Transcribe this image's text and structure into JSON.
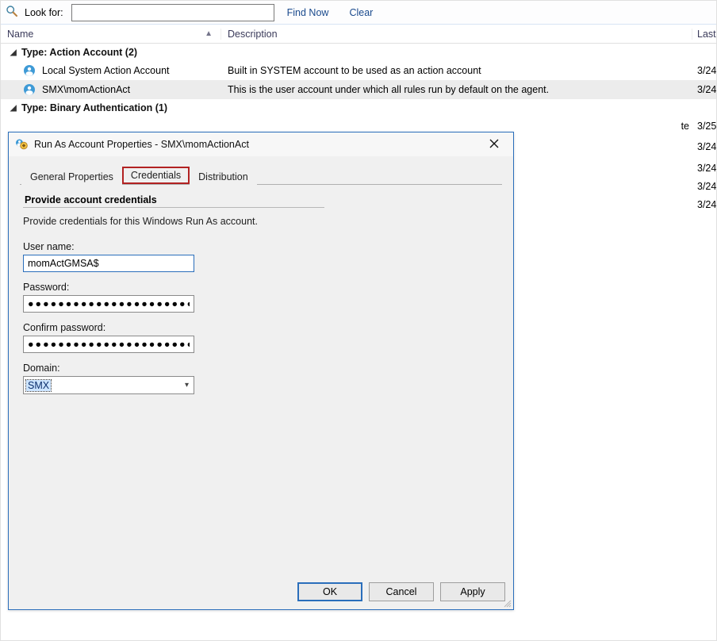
{
  "search": {
    "label": "Look for:",
    "value": "",
    "findNow": "Find Now",
    "clear": "Clear"
  },
  "columns": {
    "name": "Name",
    "description": "Description",
    "last": "Last"
  },
  "groups": [
    {
      "title": "Type: Action Account (2)",
      "rows": [
        {
          "name": "Local System Action Account",
          "desc": "Built in SYSTEM account to be used as an action account",
          "date": "3/24",
          "selected": false
        },
        {
          "name": "SMX\\momActionAct",
          "desc": "This is the user account under which all rules run by default on the agent.",
          "date": "3/24",
          "selected": true
        }
      ]
    },
    {
      "title": "Type: Binary Authentication (1)",
      "rows": []
    }
  ],
  "obscured_rows": [
    {
      "tail": "te",
      "date": "3/25"
    },
    {
      "date": "3/24"
    },
    {
      "date": "3/24"
    },
    {
      "date": "3/24"
    },
    {
      "date": "3/24"
    }
  ],
  "dialog": {
    "title": "Run As Account Properties - SMX\\momActionAct",
    "tabs": {
      "general": "General Properties",
      "credentials": "Credentials",
      "distribution": "Distribution"
    },
    "panel": {
      "heading": "Provide account credentials",
      "subtext": "Provide credentials for this Windows Run As account.",
      "username_label": "User name:",
      "username_value": "momActGMSA$",
      "password_label": "Password:",
      "password_mask": "●●●●●●●●●●●●●●●●●●●●●●●●●●●●●●●●",
      "confirm_label": "Confirm password:",
      "confirm_mask": "●●●●●●●●●●●●●●●●●●●●●●●●●●●●●●●●",
      "domain_label": "Domain:",
      "domain_value": "SMX"
    },
    "buttons": {
      "ok": "OK",
      "cancel": "Cancel",
      "apply": "Apply"
    }
  }
}
